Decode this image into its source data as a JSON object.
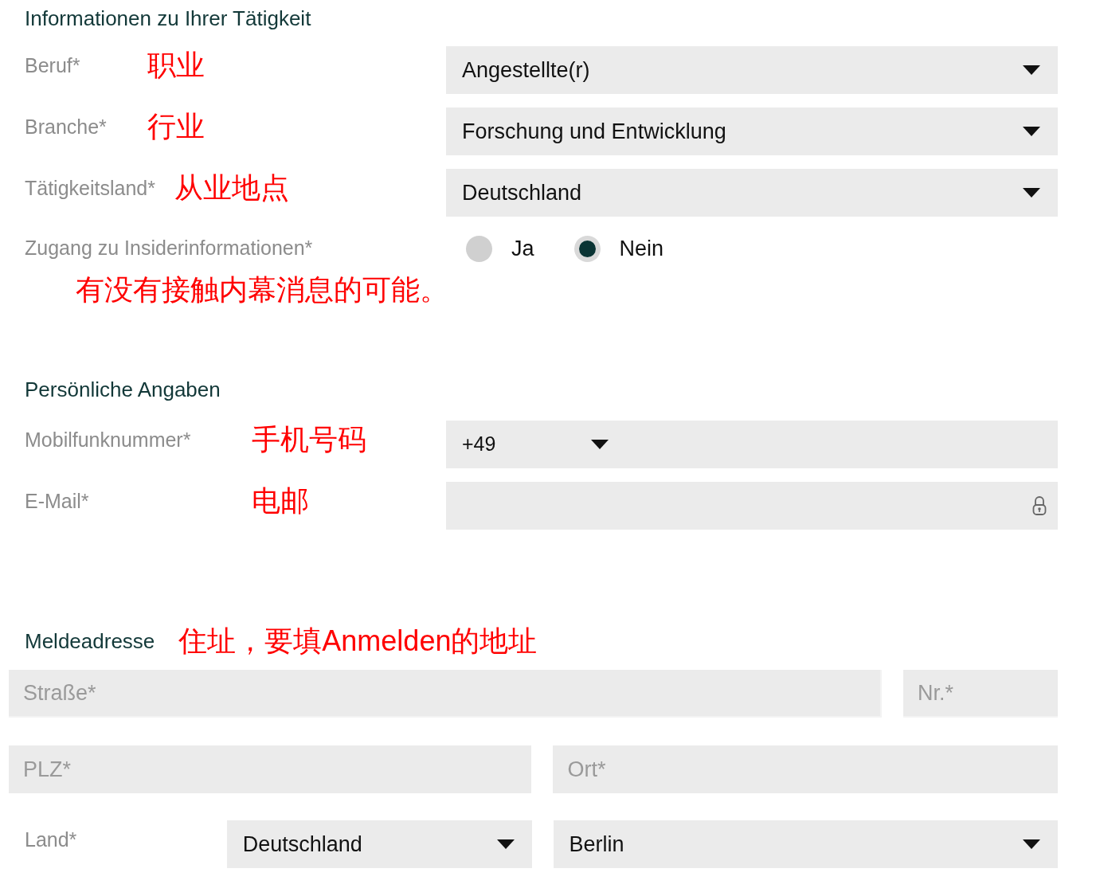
{
  "activity": {
    "title": "Informationen zu Ihrer Tätigkeit",
    "fields": [
      {
        "kind": "select",
        "label": "Beruf*",
        "note": "职业",
        "value": "Angestellte(r)"
      },
      {
        "kind": "select",
        "label": "Branche*",
        "note": "行业",
        "value": "Forschung und Entwicklung"
      },
      {
        "kind": "select",
        "label": "Tätigkeitsland*",
        "note": "从业地点",
        "value": "Deutschland"
      },
      {
        "kind": "radio",
        "label": "Zugang zu Insiderinformationen*",
        "options": [
          {
            "label": "Ja",
            "selected": false
          },
          {
            "label": "Nein",
            "selected": true
          }
        ]
      }
    ],
    "note": "有没有接触内幕消息的可能。"
  },
  "personal": {
    "title": "Persönliche Angaben",
    "fields": [
      {
        "kind": "phone",
        "label": "Mobilfunknummer*",
        "note": "手机号码",
        "value": "+49"
      },
      {
        "kind": "email",
        "label": "E-Mail*",
        "note": "电邮"
      }
    ]
  },
  "address": {
    "title": "Meldeadresse",
    "note": "住址，要填Anmelden的地址",
    "street": {
      "placeholder": "Straße*"
    },
    "number": {
      "placeholder": "Nr.*"
    },
    "postcode": {
      "placeholder": "PLZ*"
    },
    "city": {
      "placeholder": "Ort*"
    },
    "country": {
      "label": "Land*",
      "value": "Deutschland"
    },
    "region": {
      "value": "Berlin"
    }
  }
}
